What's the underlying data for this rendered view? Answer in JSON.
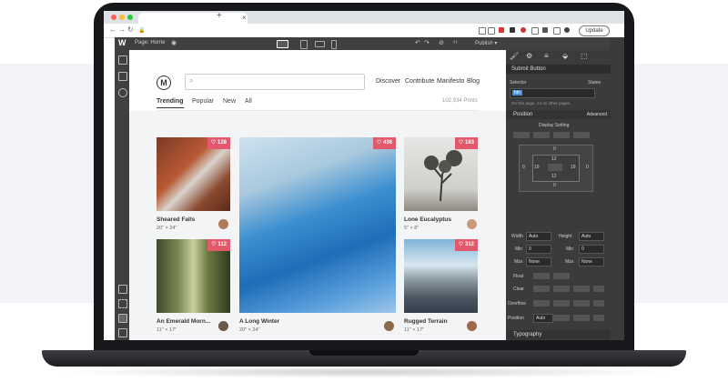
{
  "browser": {
    "dots": [
      "#ff5f57",
      "#febc2e",
      "#28c840"
    ],
    "new_tab": "+",
    "tab_close": "×",
    "nav": [
      "←",
      "→",
      "↻",
      "🔒"
    ],
    "update_label": "Update"
  },
  "designer": {
    "logo": "W",
    "page_label": "Page: Home",
    "publish_label": "Publish ▾",
    "toolbar_glyphs": [
      "↶",
      "↷",
      "⊘",
      "‹›"
    ],
    "panel_glyphs": [
      "🖌",
      "⚙",
      "≡",
      "⬙",
      "⬚"
    ]
  },
  "site": {
    "logo": "M",
    "search_icon": "⌕",
    "nav": [
      "Discover",
      "Contribute",
      "Manifesto",
      "Blog"
    ],
    "tabs": [
      "Trending",
      "Popular",
      "New",
      "All"
    ],
    "active_tab": "Trending",
    "prints_count": "102,934 Prints",
    "cards": [
      {
        "title": "Sheared Falls",
        "size": "20\" × 24\"",
        "likes": "128"
      },
      {
        "title": "An Emerald Morn...",
        "size": "11\" × 17\"",
        "likes": "112"
      },
      {
        "title": "A Long Winter",
        "size": "20\" × 24\"",
        "likes": "436"
      },
      {
        "title": "Lone Eucalyptus",
        "size": "5\" × 8\"",
        "likes": "183"
      },
      {
        "title": "Rugged Terrain",
        "size": "11\" × 17\"",
        "likes": "312"
      }
    ],
    "heart_icon": "♡"
  },
  "style_panel": {
    "element": "Submit Button",
    "selector_label": "Selector",
    "states_label": "States",
    "selector_tag": "btn",
    "info": "On this page, 24 on other pages.",
    "position_label": "Position",
    "advanced_label": "Advanced",
    "display_label": "Display Setting",
    "margin_values": [
      "0",
      "0",
      "0",
      "0"
    ],
    "padding_values": [
      "12",
      "19",
      "12",
      "19"
    ],
    "width_label": "Width",
    "width_value": "Auto",
    "height_label": "Height",
    "height_value": "Auto",
    "min_label": "Min",
    "min_w": "0",
    "min_h": "0",
    "max_label": "Max",
    "max_w": "None",
    "max_h": "None",
    "float_label": "Float",
    "clear_label": "Clear",
    "overflow_label": "Overflow",
    "position_row_label": "Position",
    "position_value": "Auto",
    "typography_label": "Typography"
  },
  "colors": {
    "accent": "#e4586b",
    "panel": "#3b3b3b",
    "toolbar": "#404040"
  }
}
